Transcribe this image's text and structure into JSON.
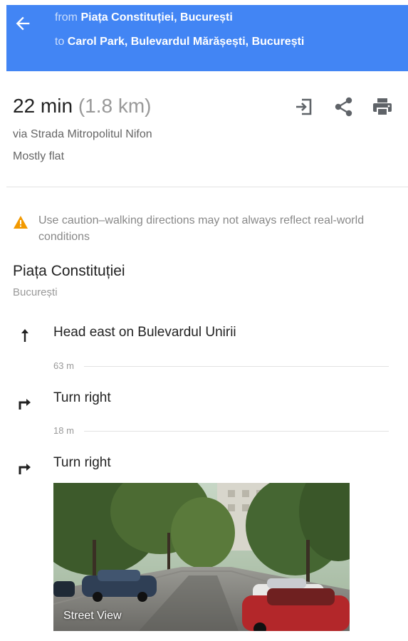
{
  "header": {
    "from_prefix": "from",
    "from_place": "Piața Constituției, București",
    "to_prefix": "to",
    "to_place": "Carol Park, Bulevardul Mărășești, București",
    "bg_color": "#4285f4"
  },
  "summary": {
    "duration": "22 min",
    "distance": "(1.8 km)",
    "via": "via Strada Mitropolitul Nifon",
    "elevation": "Mostly flat",
    "actions": [
      "send-to-device-icon",
      "share-icon",
      "print-icon"
    ]
  },
  "warning": {
    "text": "Use caution–walking directions may not always reflect real-world conditions",
    "icon_color": "#f29900"
  },
  "origin": {
    "name": "Piața Constituției",
    "city": "București"
  },
  "steps": [
    {
      "icon": "arrow-up-icon",
      "text": "Head east on Bulevardul Unirii",
      "distance": "63 m"
    },
    {
      "icon": "turn-right-icon",
      "text": "Turn right",
      "distance": "18 m"
    },
    {
      "icon": "turn-right-icon",
      "text": "Turn right",
      "distance": ""
    }
  ],
  "street_view": {
    "label": "Street View"
  }
}
